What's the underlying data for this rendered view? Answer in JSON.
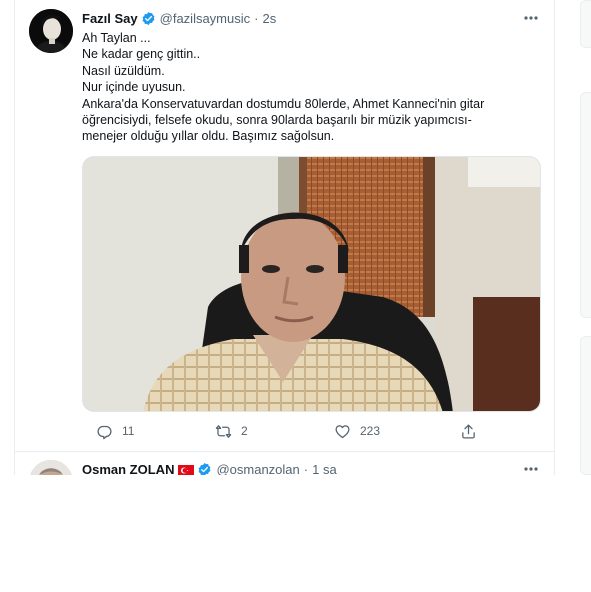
{
  "tweets": [
    {
      "author_name": "Fazıl Say",
      "handle": "@fazilsaymusic",
      "separator": "·",
      "time": "2s",
      "lines": [
        "Ah Taylan ...",
        "Ne kadar genç gittin..",
        "Nasıl üzüldüm.",
        "Nur içinde uyusun.",
        "Ankara'da Konservatuvardan dostumdu 80lerde, Ahmet Kanneci'nin gitar",
        "öğrencisiydi, felsefe okudu, sonra 90larda başarılı bir müzik yapımcısı-",
        "menejer olduğu yıllar oldu. Başımız sağolsun."
      ],
      "replies": "11",
      "retweets": "2",
      "likes": "223"
    },
    {
      "author_name": "Osman ZOLAN",
      "handle": "@osmanzolan",
      "separator": "·",
      "time": "1 sa"
    }
  ],
  "icons": {
    "verified": "verified-badge-icon",
    "more": "more-dots-icon",
    "reply": "reply-icon",
    "retweet": "retweet-icon",
    "like": "heart-icon",
    "share": "share-icon",
    "flag": "turkey-flag-icon"
  },
  "colors": {
    "verified_blue": "#1d9bf0",
    "text_primary": "#0f1419",
    "text_secondary": "#536471",
    "divider": "#ebeef0",
    "flag_red": "#e30a17"
  }
}
